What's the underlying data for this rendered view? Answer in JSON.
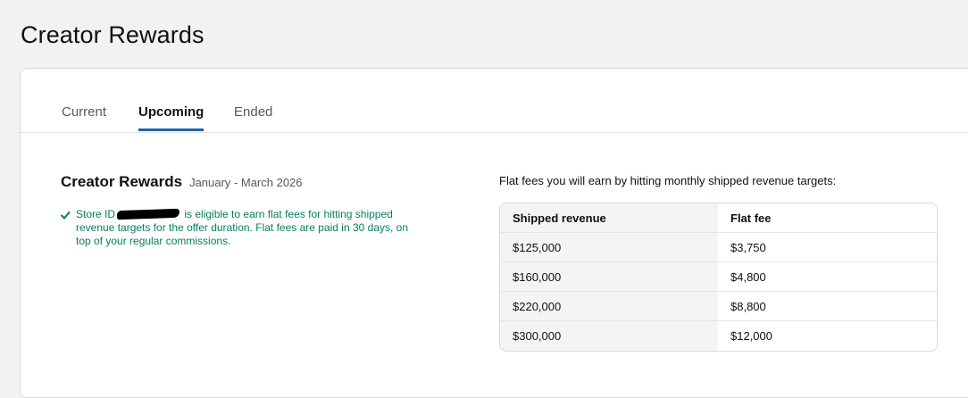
{
  "page": {
    "title": "Creator Rewards"
  },
  "tabs": [
    {
      "label": "Current",
      "active": false
    },
    {
      "label": "Upcoming",
      "active": true
    },
    {
      "label": "Ended",
      "active": false
    }
  ],
  "offer": {
    "title": "Creator Rewards",
    "dates": "January - March 2026",
    "eligibility_prefix": "Store ID",
    "eligibility_text": "is eligible to earn flat fees for hitting shipped revenue targets for the offer duration. Flat fees are paid in 30 days, on top of your regular commissions.",
    "status_color": "#067d62"
  },
  "fees": {
    "caption": "Flat fees you will earn by hitting monthly shipped revenue targets:",
    "headers": [
      "Shipped revenue",
      "Flat fee"
    ],
    "rows": [
      [
        "$125,000",
        "$3,750"
      ],
      [
        "$160,000",
        "$4,800"
      ],
      [
        "$220,000",
        "$8,800"
      ],
      [
        "$300,000",
        "$12,000"
      ]
    ]
  },
  "colors": {
    "accent": "#2162a1",
    "success": "#067d62"
  }
}
